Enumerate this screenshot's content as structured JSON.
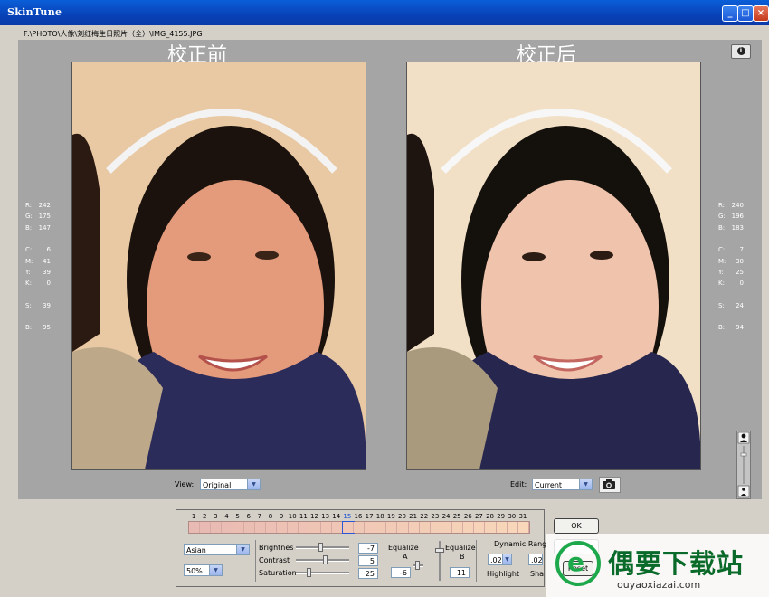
{
  "window": {
    "title": "SkinTune",
    "min_icon": "minimize-icon",
    "max_icon": "maximize-icon",
    "close_icon": "close-icon"
  },
  "file_path": "F:\\PHOTO\\人像\\刘红梅生日照片（全）\\IMG_4155.JPG",
  "before": {
    "heading": "校正前"
  },
  "after": {
    "heading": "校正后"
  },
  "readout_left": [
    {
      "label": "R:",
      "value": "242"
    },
    {
      "label": "G:",
      "value": "175"
    },
    {
      "label": "B:",
      "value": "147"
    },
    {
      "label": "C:",
      "value": "6"
    },
    {
      "label": "M:",
      "value": "41"
    },
    {
      "label": "Y:",
      "value": "39"
    },
    {
      "label": "K:",
      "value": "0"
    },
    {
      "label": "S:",
      "value": "39"
    },
    {
      "label": "B:",
      "value": "95"
    }
  ],
  "readout_right": [
    {
      "label": "R:",
      "value": "240"
    },
    {
      "label": "G:",
      "value": "196"
    },
    {
      "label": "B:",
      "value": "183"
    },
    {
      "label": "C:",
      "value": "7"
    },
    {
      "label": "M:",
      "value": "30"
    },
    {
      "label": "Y:",
      "value": "25"
    },
    {
      "label": "K:",
      "value": "0"
    },
    {
      "label": "S:",
      "value": "24"
    },
    {
      "label": "B:",
      "value": "94"
    }
  ],
  "view": {
    "label": "View:",
    "value": "Original"
  },
  "edit": {
    "label": "Edit:",
    "value": "Current"
  },
  "palette": {
    "numbers": [
      "1",
      "2",
      "3",
      "4",
      "5",
      "6",
      "7",
      "8",
      "9",
      "10",
      "11",
      "12",
      "13",
      "14",
      "15",
      "16",
      "17",
      "18",
      "19",
      "20",
      "21",
      "22",
      "23",
      "24",
      "25",
      "26",
      "27",
      "28",
      "29",
      "30",
      "31"
    ],
    "selected_index": 14,
    "colors": [
      "#e9b9b3",
      "#e9bab3",
      "#eabbb3",
      "#eabcb3",
      "#ebbdb3",
      "#ebbeb3",
      "#ecbfb4",
      "#ecc0b4",
      "#edc1b4",
      "#edc2b4",
      "#eec3b5",
      "#eec4b5",
      "#efc5b5",
      "#efc6b5",
      "#f0c7b6",
      "#f0c8b6",
      "#f1c9b6",
      "#f1cab6",
      "#f2cbb7",
      "#f2ccb7",
      "#f3cdb7",
      "#f3ceb7",
      "#f4cfb8",
      "#f4d0b8",
      "#f5d1b8",
      "#f5d2b8",
      "#f6d3b9",
      "#f6d4b9",
      "#f7d5b9",
      "#f7d6b9",
      "#f8d7ba"
    ]
  },
  "controls": {
    "skin_type": "Asian",
    "zoom": "50%",
    "brightness": {
      "label": "Brightnes",
      "value": "-7",
      "level": 0.46
    },
    "contrast": {
      "label": "Contrast",
      "value": "5",
      "level": 0.55
    },
    "saturation": {
      "label": "Saturation",
      "value": "25",
      "level": 0.22
    },
    "equalize_a": {
      "label_top": "Equalize",
      "label_bottom": "A",
      "value": "-6"
    },
    "equalize_b": {
      "label_top": "Equalize",
      "label_bottom": "B",
      "value": "11"
    },
    "dynamic_range": {
      "label": "Dynamic Rang",
      "highlight_value": ".02",
      "shadow_value": ".02",
      "highlight_label": "Highlight",
      "shadow_label": "Sha"
    }
  },
  "buttons": {
    "ok": "OK",
    "reset": "Reset"
  },
  "watermark": {
    "title": "偶要下载站",
    "url": "ouyaoxiazai.com",
    "logo_glyph": "e"
  }
}
